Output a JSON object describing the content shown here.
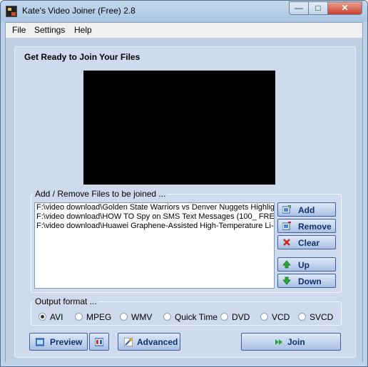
{
  "window": {
    "title": "Kate's Video Joiner (Free) 2.8",
    "minimize_label": "—",
    "maximize_label": "□",
    "close_label": "✕"
  },
  "menu": {
    "file": "File",
    "settings": "Settings",
    "help": "Help"
  },
  "panel": {
    "title": "Get Ready to Join Your Files"
  },
  "files_group": {
    "label": "Add / Remove Files to be joined ...",
    "files": [
      "F:\\video download\\Golden State Warriors vs Denver Nuggets  Highlig",
      "F:\\video download\\HOW TO Spy on SMS Text Messages (100_ FRE",
      "F:\\video download\\Huawei Graphene-Assisted High-Temperature Li-ic"
    ],
    "buttons": {
      "add": "Add",
      "remove": "Remove",
      "clear": "Clear",
      "up": "Up",
      "down": "Down"
    }
  },
  "output_group": {
    "label": "Output format ...",
    "options": [
      "AVI",
      "MPEG",
      "WMV",
      "Quick Time",
      "DVD",
      "VCD",
      "SVCD"
    ],
    "selected": "AVI"
  },
  "bottom": {
    "preview": "Preview",
    "advanced": "Advanced",
    "join": "Join"
  },
  "colors": {
    "button_text": "#12306d",
    "button_border": "#3e5f99",
    "panel_bg": "#cfdbed"
  }
}
